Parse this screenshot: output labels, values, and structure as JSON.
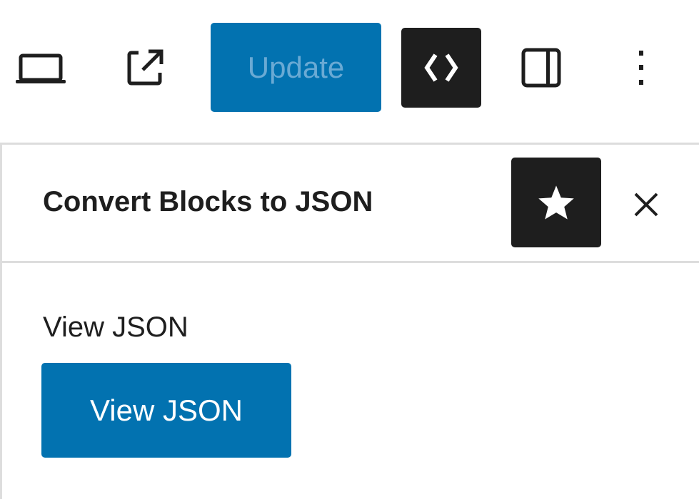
{
  "toolbar": {
    "update_label": "Update",
    "colors": {
      "primary": "#0272b0",
      "dark": "#1e1e1e"
    }
  },
  "panel": {
    "title": "Convert Blocks to JSON",
    "section_label": "View JSON",
    "button_label": "View JSON"
  }
}
